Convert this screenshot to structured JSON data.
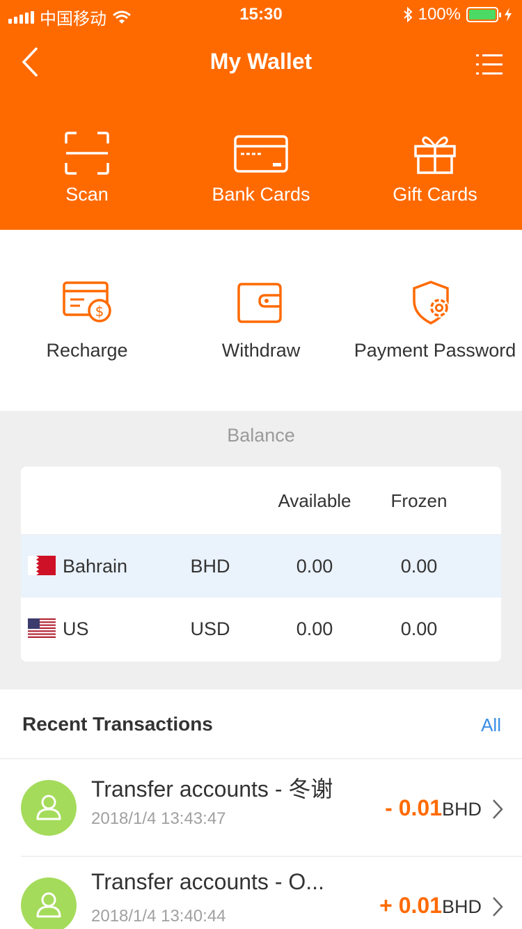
{
  "status_bar": {
    "carrier": "中国移动",
    "time": "15:30",
    "battery": "100%"
  },
  "nav": {
    "title": "My Wallet"
  },
  "quick_actions": [
    {
      "label": "Scan",
      "icon": "scan-icon"
    },
    {
      "label": "Bank Cards",
      "icon": "bank-card-icon"
    },
    {
      "label": "Gift Cards",
      "icon": "gift-icon"
    }
  ],
  "actions": [
    {
      "label": "Recharge",
      "icon": "recharge-icon"
    },
    {
      "label": "Withdraw",
      "icon": "wallet-icon"
    },
    {
      "label": "Payment Password",
      "icon": "shield-gear-icon"
    }
  ],
  "balance": {
    "title": "Balance",
    "headers": {
      "available": "Available",
      "frozen": "Frozen"
    },
    "rows": [
      {
        "country": "Bahrain",
        "currency": "BHD",
        "available": "0.00",
        "frozen": "0.00",
        "flag": "bahrain-flag-icon"
      },
      {
        "country": "US",
        "currency": "USD",
        "available": "0.00",
        "frozen": "0.00",
        "flag": "us-flag-icon"
      }
    ]
  },
  "transactions": {
    "title": "Recent Transactions",
    "all_label": "All",
    "items": [
      {
        "title": "Transfer accounts - 冬谢",
        "time": "2018/1/4 13:43:47",
        "amount": "- 0.01",
        "currency": "BHD"
      },
      {
        "title": "Transfer accounts - O...",
        "time": "2018/1/4 13:40:44",
        "amount": "+ 0.01",
        "currency": "BHD"
      }
    ]
  },
  "colors": {
    "brand": "#ff6a00",
    "link": "#3a8ee6",
    "avatar": "#a5db5b",
    "row_highlight": "#eaf2fb"
  }
}
